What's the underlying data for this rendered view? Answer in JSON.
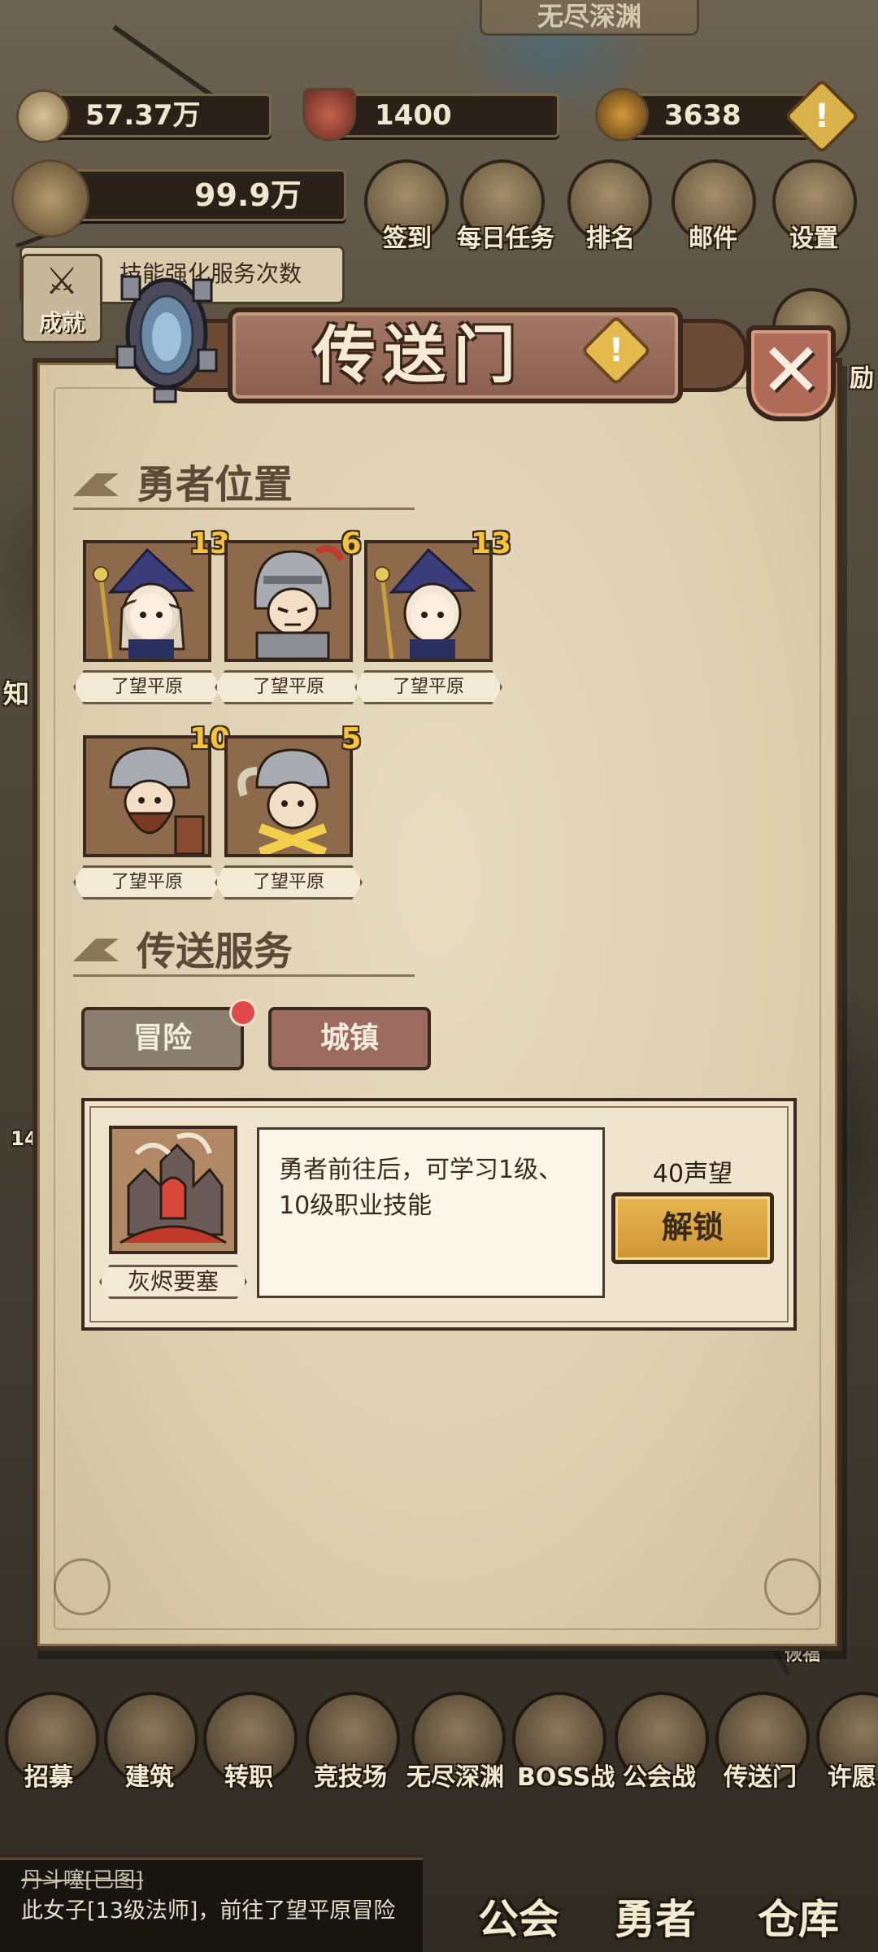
{
  "top_area": {
    "title": "无尽深渊"
  },
  "currencies": {
    "gold": "57.37万",
    "honor": "1400",
    "crystal": "3638",
    "power": "99.9万"
  },
  "top_menu": [
    {
      "label": "签到",
      "icon": "scroll-icon"
    },
    {
      "label": "每日任务",
      "icon": "quest-icon"
    },
    {
      "label": "排名",
      "icon": "crown-icon"
    },
    {
      "label": "邮件",
      "icon": "mail-icon"
    },
    {
      "label": "设置",
      "icon": "gear-icon"
    }
  ],
  "side": {
    "achievement": "成就",
    "notice": "技能强化服务次数",
    "right_label": "励",
    "left_label": "知",
    "left_number": "14",
    "right_number": "恢福"
  },
  "dialog": {
    "title": "传送门",
    "help": "!",
    "close": "✕",
    "hero_section": "勇者位置",
    "service_section": "传送服务"
  },
  "heroes": [
    {
      "level": "13",
      "location": "了望平原",
      "type": "mage"
    },
    {
      "level": "6",
      "location": "了望平原",
      "type": "knight"
    },
    {
      "level": "13",
      "location": "了望平原",
      "type": "mage"
    },
    {
      "level": "10",
      "location": "了望平原",
      "type": "viking"
    },
    {
      "level": "5",
      "location": "了望平原",
      "type": "horned"
    }
  ],
  "tabs": {
    "adventure": "冒险",
    "town": "城镇"
  },
  "service": {
    "name": "灰烬要塞",
    "description": "勇者前往后，可学习1级、10级职业技能",
    "cost": "40声望",
    "unlock": "解锁"
  },
  "bottom_nav": [
    {
      "label": "招募"
    },
    {
      "label": "建筑"
    },
    {
      "label": "转职"
    },
    {
      "label": "竞技场"
    },
    {
      "label": "无尽深渊"
    },
    {
      "label": "BOSS战"
    },
    {
      "label": "公会战"
    },
    {
      "label": "传送门"
    },
    {
      "label": "许愿"
    }
  ],
  "chat": {
    "sender": "丹斗噻[已图]",
    "message": "此女子[13级法师]，前往了望平原冒险"
  },
  "main_tabs": {
    "guild": "公会",
    "hero": "勇者",
    "storage": "仓库"
  },
  "colors": {
    "parchment": "#ddcfae",
    "banner": "#8a5f4f",
    "unlock_button": "#e7b551",
    "level_gold": "#f6c338",
    "badge_red": "#e0484b"
  }
}
